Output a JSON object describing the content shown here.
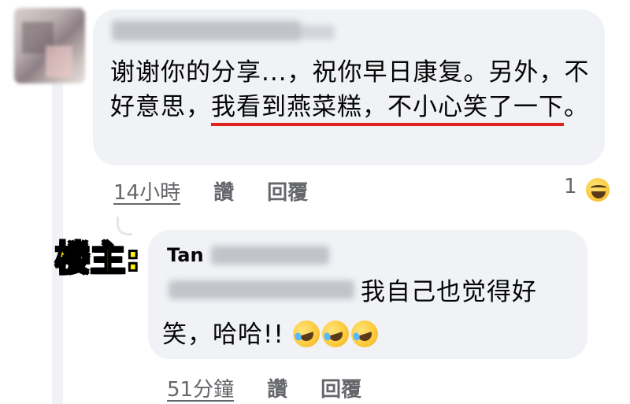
{
  "comment": {
    "text_before": "谢谢你的分享...，祝你早日康复。另外，不好意思，",
    "text_highlight_a": "我看到燕菜糕，不小",
    "text_highlight_b": "心笑了一下",
    "text_after": "。",
    "time": "14小時",
    "like": "讚",
    "reply": "回覆",
    "reaction_count": "1",
    "reaction_icon": "laugh-emoji"
  },
  "owner_label": "楼主:",
  "reply": {
    "author_visible": "Tan",
    "text_line1": "我自己也觉得好",
    "text_line2": "笑，哈哈!!",
    "emojis": [
      "rolling-laugh-emoji",
      "rolling-laugh-emoji",
      "rolling-laugh-emoji"
    ],
    "time": "51分鐘",
    "like": "讚",
    "reply": "回覆"
  },
  "colors": {
    "bubble": "#f0f2f5",
    "meta_text": "#65676b",
    "highlight_underline": "#e0221e",
    "owner_label": "#fff200"
  }
}
